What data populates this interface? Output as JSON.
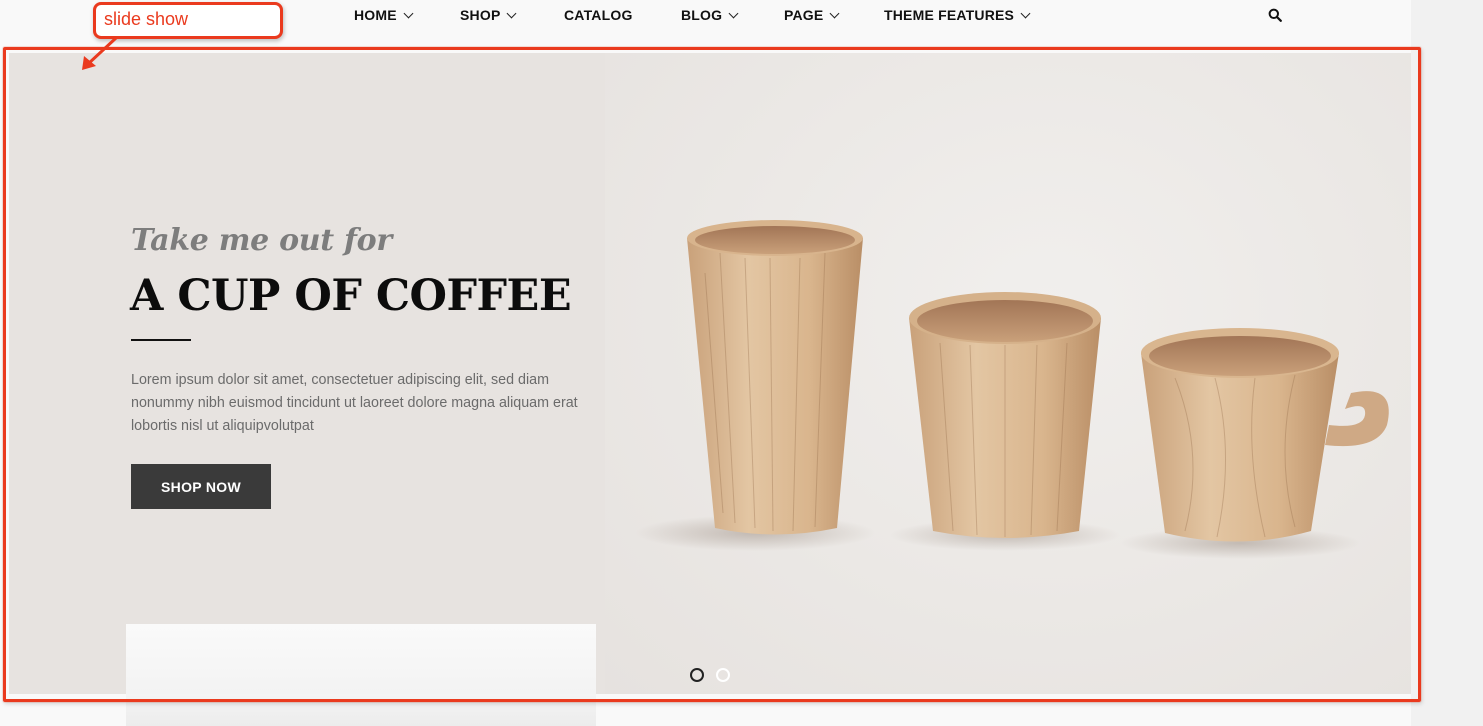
{
  "annotation": {
    "label": "slide show",
    "color": "#ea3a1e"
  },
  "nav": {
    "items": [
      {
        "label": "HOME",
        "has_dropdown": true
      },
      {
        "label": "SHOP",
        "has_dropdown": true
      },
      {
        "label": "CATALOG",
        "has_dropdown": false
      },
      {
        "label": "BLOG",
        "has_dropdown": true
      },
      {
        "label": "PAGE",
        "has_dropdown": true
      },
      {
        "label": "THEME FEATURES",
        "has_dropdown": true
      }
    ],
    "search_icon": "search-icon"
  },
  "slideshow": {
    "subtitle": "Take me out for",
    "title": "A CUP OF COFFEE",
    "description": "Lorem ipsum dolor sit amet, consectetuer adipiscing elit, sed diam nonummy nibh euismod tincidunt ut laoreet dolore magna aliquam erat lobortis nisl ut aliquipvolutpat",
    "button_label": "SHOP NOW",
    "slides_total": 2,
    "active_slide": 1,
    "image_subject": "three wooden cups"
  },
  "colors": {
    "accent": "#ea3a1e",
    "button_bg": "#3a3a3a",
    "slide_bg": "#e9e5e2"
  }
}
